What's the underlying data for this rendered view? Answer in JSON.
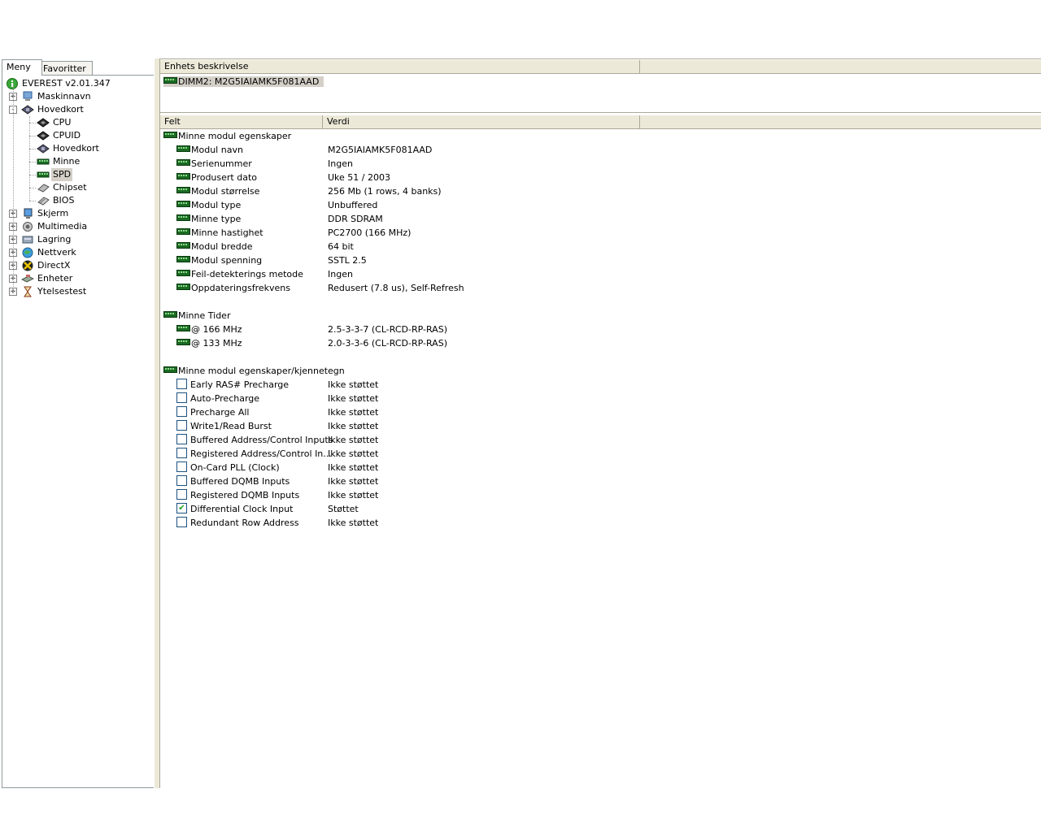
{
  "left_panel": {
    "tabs": [
      "Meny",
      "Favoritter"
    ],
    "tree": {
      "root": "EVEREST v2.01.347",
      "items": [
        {
          "label": "Maskinnavn",
          "icon": "computer-icon",
          "expander": "+"
        },
        {
          "label": "Hovedkort",
          "icon": "motherboard-icon",
          "expander": "-"
        },
        {
          "label": "CPU",
          "icon": "cpu-chip-icon"
        },
        {
          "label": "CPUID",
          "icon": "cpu-chip-icon"
        },
        {
          "label": "Hovedkort",
          "icon": "motherboard-icon"
        },
        {
          "label": "Minne",
          "icon": "memory-module-icon"
        },
        {
          "label": "SPD",
          "icon": "memory-module-icon",
          "selected": true
        },
        {
          "label": "Chipset",
          "icon": "chipset-icon"
        },
        {
          "label": "BIOS",
          "icon": "bios-chip-icon"
        },
        {
          "label": "Skjerm",
          "icon": "monitor-icon",
          "expander": "+"
        },
        {
          "label": "Multimedia",
          "icon": "speaker-icon",
          "expander": "+"
        },
        {
          "label": "Lagring",
          "icon": "storage-icon",
          "expander": "+"
        },
        {
          "label": "Nettverk",
          "icon": "globe-icon",
          "expander": "+"
        },
        {
          "label": "DirectX",
          "icon": "directx-icon",
          "expander": "+"
        },
        {
          "label": "Enheter",
          "icon": "devices-icon",
          "expander": "+"
        },
        {
          "label": "Ytelsestest",
          "icon": "hourglass-icon",
          "expander": "+"
        }
      ]
    }
  },
  "device_list": {
    "header": "Enhets beskrivelse",
    "items": [
      "DIMM2: M2G5IAIAMK5F081AAD"
    ]
  },
  "details": {
    "columns": [
      "Felt",
      "Verdi"
    ],
    "sections": [
      {
        "title": "Minne modul egenskaper",
        "rows": [
          {
            "field": "Modul navn",
            "value": "M2G5IAIAMK5F081AAD"
          },
          {
            "field": "Serienummer",
            "value": "Ingen"
          },
          {
            "field": "Produsert dato",
            "value": "Uke 51 / 2003"
          },
          {
            "field": "Modul størrelse",
            "value": "256 Mb (1 rows, 4 banks)"
          },
          {
            "field": "Modul type",
            "value": "Unbuffered"
          },
          {
            "field": "Minne type",
            "value": "DDR SDRAM"
          },
          {
            "field": "Minne hastighet",
            "value": "PC2700 (166 MHz)"
          },
          {
            "field": "Modul bredde",
            "value": "64 bit"
          },
          {
            "field": "Modul spenning",
            "value": "SSTL 2.5"
          },
          {
            "field": "Feil-detekterings metode",
            "value": "Ingen"
          },
          {
            "field": "Oppdateringsfrekvens",
            "value": "Redusert (7.8 us), Self-Refresh"
          }
        ]
      },
      {
        "title": "Minne Tider",
        "rows": [
          {
            "field": "@ 166 MHz",
            "value": "2.5-3-3-7  (CL-RCD-RP-RAS)"
          },
          {
            "field": "@ 133 MHz",
            "value": "2.0-3-3-6  (CL-RCD-RP-RAS)"
          }
        ]
      },
      {
        "title": "Minne modul egenskaper/kjennetegn",
        "rows": [
          {
            "field": "Early RAS# Precharge",
            "value": "Ikke støttet",
            "checked": false
          },
          {
            "field": "Auto-Precharge",
            "value": "Ikke støttet",
            "checked": false
          },
          {
            "field": "Precharge All",
            "value": "Ikke støttet",
            "checked": false
          },
          {
            "field": "Write1/Read Burst",
            "value": "Ikke støttet",
            "checked": false
          },
          {
            "field": "Buffered Address/Control Inputs",
            "value": "Ikke støttet",
            "checked": false
          },
          {
            "field": "Registered Address/Control In...",
            "value": "Ikke støttet",
            "checked": false
          },
          {
            "field": "On-Card PLL (Clock)",
            "value": "Ikke støttet",
            "checked": false
          },
          {
            "field": "Buffered DQMB Inputs",
            "value": "Ikke støttet",
            "checked": false
          },
          {
            "field": "Registered DQMB Inputs",
            "value": "Ikke støttet",
            "checked": false
          },
          {
            "field": "Differential Clock Input",
            "value": "Støttet",
            "checked": true
          },
          {
            "field": "Redundant Row Address",
            "value": "Ikke støttet",
            "checked": false
          }
        ]
      }
    ]
  }
}
